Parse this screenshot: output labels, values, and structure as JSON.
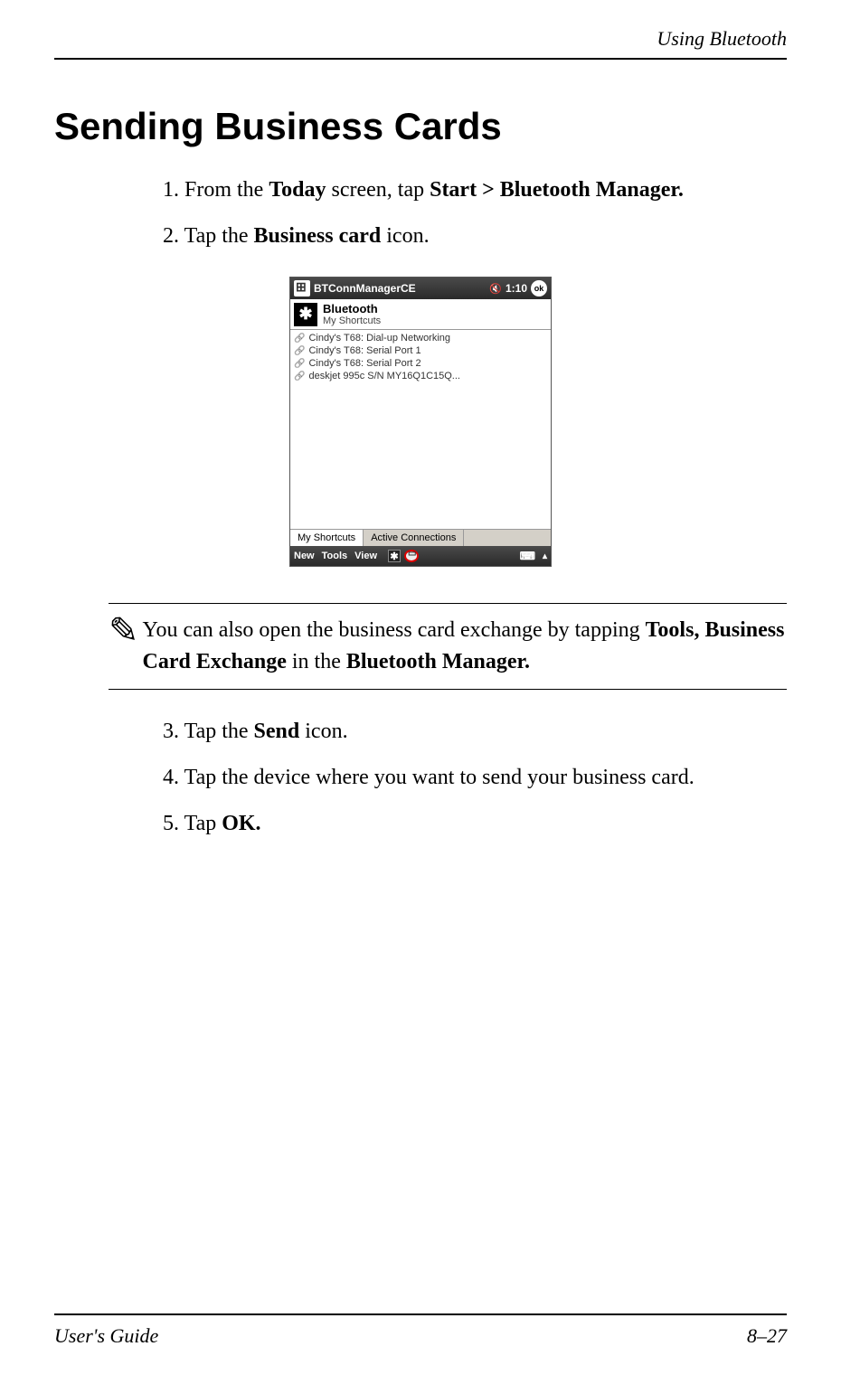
{
  "header": {
    "chapter": "Using Bluetooth"
  },
  "heading": "Sending Business Cards",
  "steps": {
    "s1": {
      "num": "1.",
      "a": "From the ",
      "b": "Today",
      "c": " screen, tap ",
      "d": "Start > Bluetooth Manager."
    },
    "s2": {
      "num": "2.",
      "a": "Tap the ",
      "b": "Business card",
      "c": " icon."
    },
    "s3": {
      "num": "3.",
      "a": "Tap the ",
      "b": "Send",
      "c": " icon."
    },
    "s4": {
      "num": "4.",
      "a": "Tap the device where you want to send your business card."
    },
    "s5": {
      "num": "5.",
      "a": "Tap ",
      "b": "OK."
    }
  },
  "note": {
    "icon": "✎",
    "a": "You can also open the business card exchange by tapping ",
    "b": "Tools, Business Card Exchange",
    "c": " in the ",
    "d": "Bluetooth Manager."
  },
  "screenshot": {
    "titlebar": {
      "app": "BTConnManagerCE",
      "time": "1:10",
      "ok": "ok"
    },
    "appheader": {
      "title": "Bluetooth",
      "subtitle": "My Shortcuts",
      "bt_glyph": "✱"
    },
    "shortcuts": [
      "Cindy's T68: Dial-up Networking",
      "Cindy's T68: Serial Port 1",
      "Cindy's T68: Serial Port 2",
      "deskjet 995c S/N MY16Q1C15Q..."
    ],
    "tabs": {
      "left": "My Shortcuts",
      "right": "Active Connections"
    },
    "bottombar": {
      "new": "New",
      "tools": "Tools",
      "view": "View"
    }
  },
  "footer": {
    "left": "User's Guide",
    "right": "8–27"
  }
}
